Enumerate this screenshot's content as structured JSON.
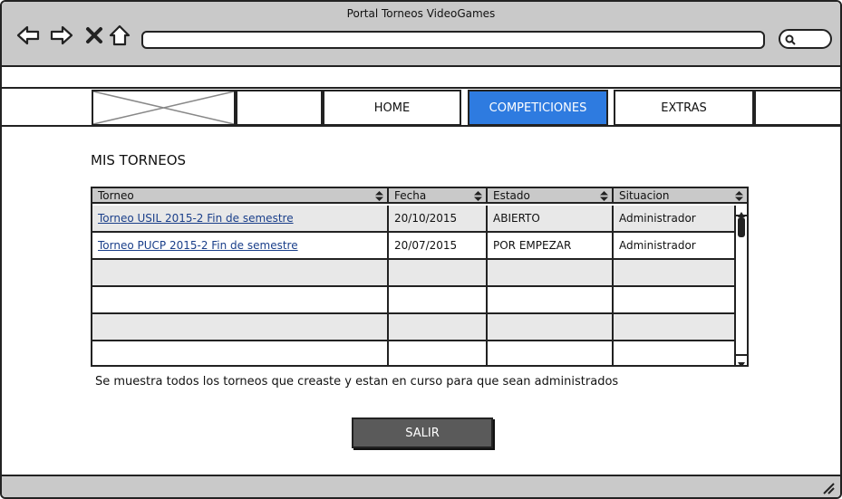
{
  "window": {
    "title": "Portal Torneos VideoGames"
  },
  "nav": {
    "items": [
      {
        "label": "HOME"
      },
      {
        "label": "COMPETICIONES"
      },
      {
        "label": "EXTRAS"
      }
    ],
    "active_color": "#2e7be0"
  },
  "main": {
    "heading": "MIS TORNEOS",
    "table": {
      "columns": [
        "Torneo",
        "Fecha",
        "Estado",
        "Situacion"
      ],
      "rows": [
        {
          "torneo": "Torneo USIL 2015-2 Fin de semestre",
          "fecha": "20/10/2015",
          "estado": "ABIERTO",
          "situacion": "Administrador"
        },
        {
          "torneo": "Torneo PUCP 2015-2 Fin de semestre",
          "fecha": "20/07/2015",
          "estado": "POR EMPEZAR",
          "situacion": "Administrador"
        }
      ]
    },
    "note": "Se muestra todos los torneos que creaste y estan en curso para que sean administrados",
    "exit_label": "SALIR"
  },
  "icons": [
    "back-icon",
    "forward-icon",
    "close-icon",
    "home-icon",
    "search-icon",
    "sort-icon",
    "scroll-up-icon",
    "scroll-down-icon",
    "resize-icon"
  ]
}
